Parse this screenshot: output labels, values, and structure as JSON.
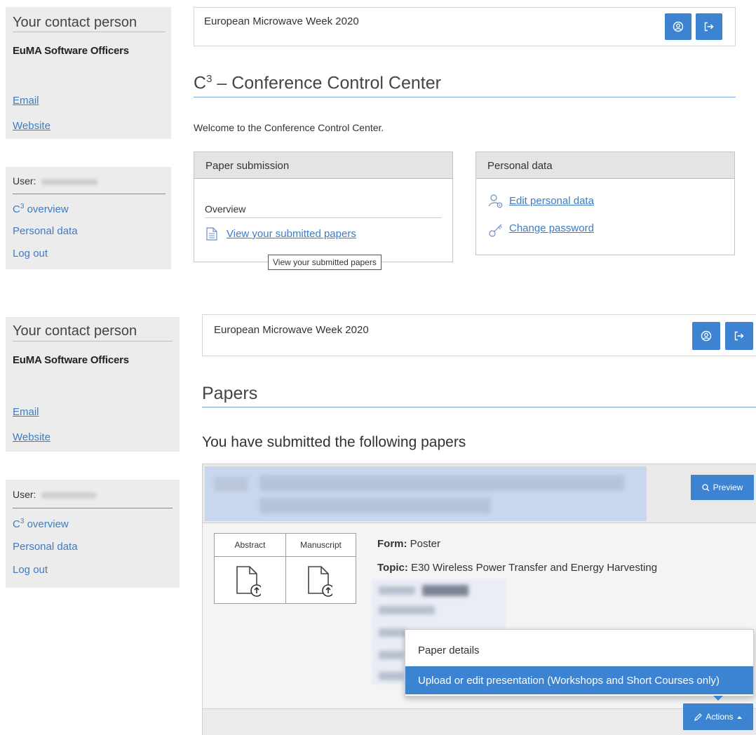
{
  "colors": {
    "accent": "#3c83d2",
    "link": "#3c7cc4",
    "sidebar_bg": "#ececec",
    "heading_rule": "#79a7d8"
  },
  "screens": [
    {
      "contact": {
        "title": "Your contact person",
        "name": "EuMA Software Officers",
        "email_link": "Email",
        "website_link": "Website"
      },
      "user": {
        "label": "User:",
        "nav": {
          "overview_prefix": "C",
          "overview_sup": "3",
          "overview_suffix": " overview",
          "personal_data": "Personal data",
          "logout": "Log out"
        }
      },
      "header": {
        "event": "European Microwave Week 2020",
        "profile_icon": "user-circle-icon",
        "logout_icon": "logout-icon"
      },
      "heading": {
        "prefix": "C",
        "sup": "3",
        "suffix": " – Conference Control Center"
      },
      "welcome": "Welcome to the Conference Control Center.",
      "cards": {
        "submission": {
          "title": "Paper submission",
          "overview_label": "Overview",
          "view_link": "View your submitted papers",
          "tooltip": "View your submitted papers"
        },
        "personal": {
          "title": "Personal data",
          "edit_link": "Edit personal data",
          "password_link": "Change password"
        }
      }
    },
    {
      "contact": {
        "title": "Your contact person",
        "name": "EuMA Software Officers",
        "email_link": "Email",
        "website_link": "Website"
      },
      "user": {
        "label": "User:",
        "nav": {
          "overview_prefix": "C",
          "overview_sup": "3",
          "overview_suffix": " overview",
          "personal_data": "Personal data",
          "logout": "Log out"
        }
      },
      "header": {
        "event": "European Microwave Week 2020",
        "profile_icon": "user-circle-icon",
        "logout_icon": "logout-icon"
      },
      "heading": "Papers",
      "subheading": "You have submitted the following papers",
      "paper": {
        "preview_label": "Preview",
        "files": {
          "abstract": "Abstract",
          "manuscript": "Manuscript"
        },
        "form_label": "Form:",
        "form_value": " Poster",
        "topic_label": "Topic:",
        "topic_value": " E30 Wireless Power Transfer and Energy Harvesting",
        "actions_label": "Actions"
      },
      "dropdown": {
        "items": [
          "Paper details",
          "Upload or edit presentation (Workshops and Short Courses only)"
        ],
        "active_index": 1
      }
    }
  ]
}
